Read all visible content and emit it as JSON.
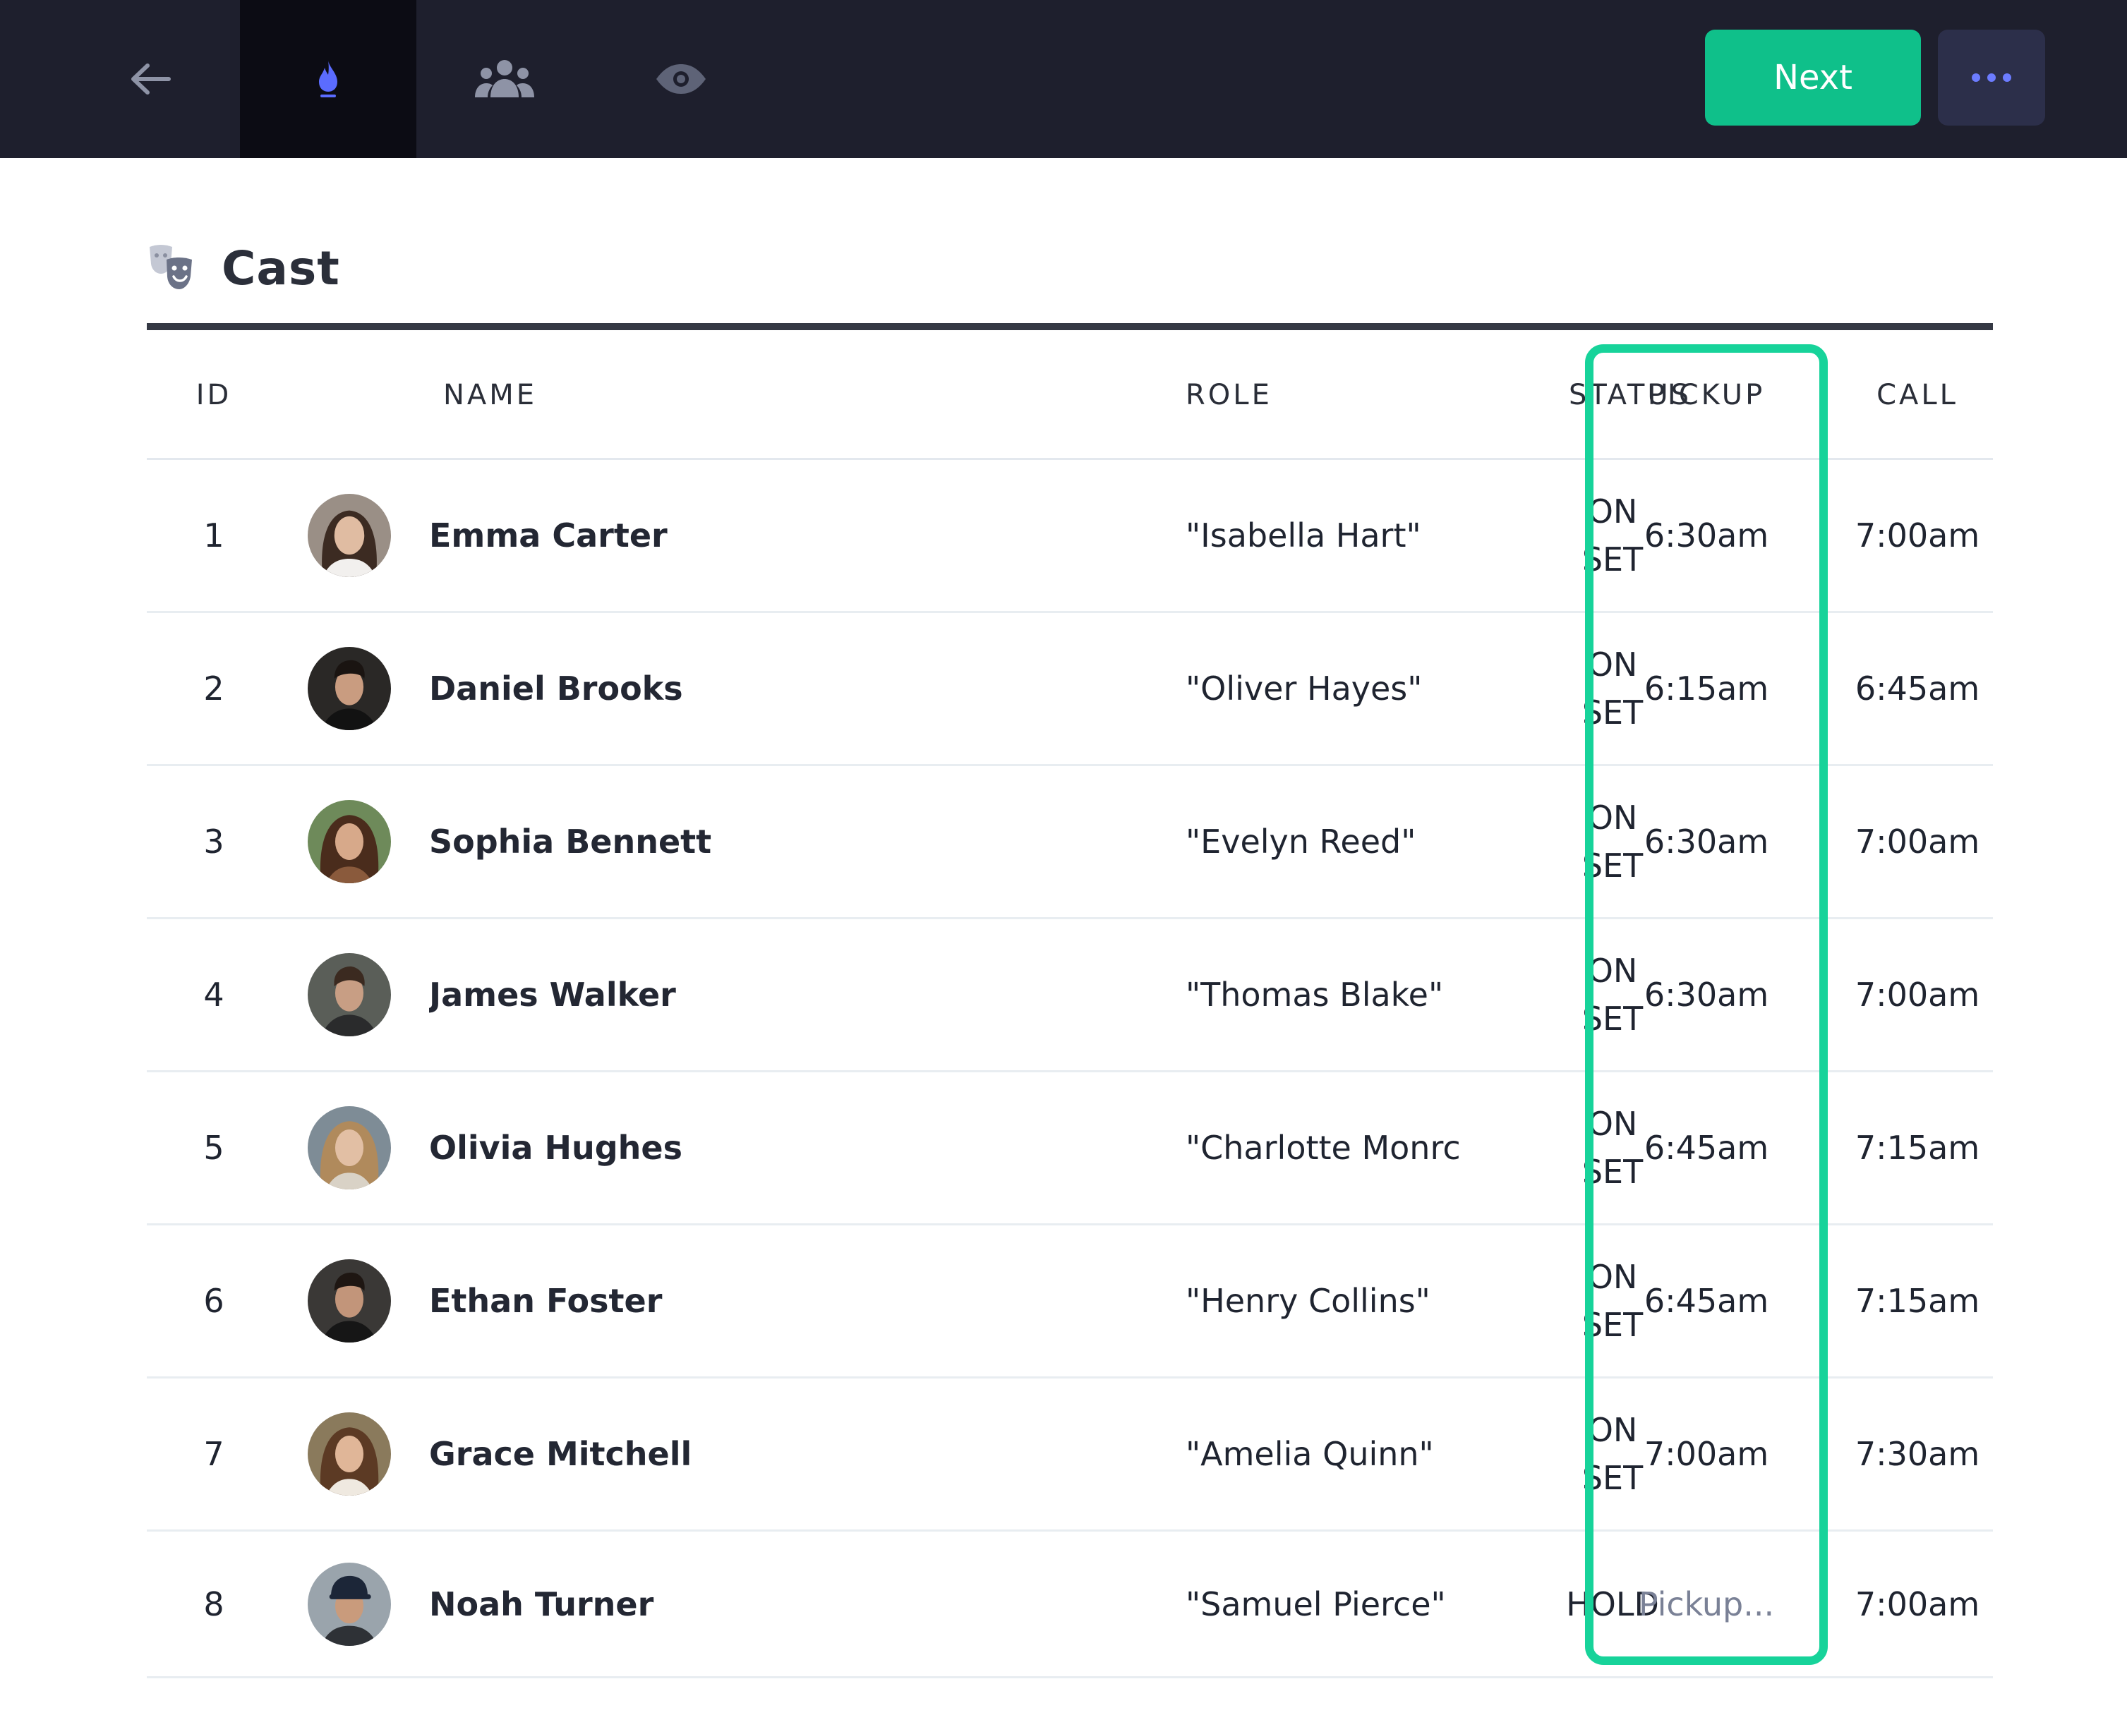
{
  "toolbar": {
    "icons": [
      "back-arrow-icon",
      "flame-icon",
      "people-group-icon",
      "eye-icon"
    ],
    "next_label": "Next",
    "more_icon": "ellipsis-icon",
    "accent_color": "#0fc08a",
    "active_icon_color": "#5b6cff"
  },
  "section": {
    "icon": "theater-masks-icon",
    "title": "Cast"
  },
  "table": {
    "headers": {
      "id": "ID",
      "name": "NAME",
      "role": "ROLE",
      "status": "STATUS",
      "pickup": "PICKUP",
      "call": "CALL"
    },
    "rows": [
      {
        "id": "1",
        "name": "Emma Carter",
        "role": "\"Isabella Hart\"",
        "status": [
          "ON",
          "SET"
        ],
        "pickup": "6:30am",
        "call": "7:00am"
      },
      {
        "id": "2",
        "name": "Daniel Brooks",
        "role": "\"Oliver Hayes\"",
        "status": [
          "ON",
          "SET"
        ],
        "pickup": "6:15am",
        "call": "6:45am"
      },
      {
        "id": "3",
        "name": "Sophia Bennett",
        "role": "\"Evelyn Reed\"",
        "status": [
          "ON",
          "SET"
        ],
        "pickup": "6:30am",
        "call": "7:00am"
      },
      {
        "id": "4",
        "name": "James Walker",
        "role": "\"Thomas Blake\"",
        "status": [
          "ON",
          "SET"
        ],
        "pickup": "6:30am",
        "call": "7:00am"
      },
      {
        "id": "5",
        "name": "Olivia Hughes",
        "role": "\"Charlotte Monrc",
        "status": [
          "ON",
          "SET"
        ],
        "pickup": "6:45am",
        "call": "7:15am"
      },
      {
        "id": "6",
        "name": "Ethan Foster",
        "role": "\"Henry Collins\"",
        "status": [
          "ON",
          "SET"
        ],
        "pickup": "6:45am",
        "call": "7:15am"
      },
      {
        "id": "7",
        "name": "Grace Mitchell",
        "role": "\"Amelia Quinn\"",
        "status": [
          "ON",
          "SET"
        ],
        "pickup": "7:00am",
        "call": "7:30am"
      },
      {
        "id": "8",
        "name": "Noah Turner",
        "role": "\"Samuel Pierce\"",
        "status": [
          "HOLD"
        ],
        "pickup": "",
        "pickup_placeholder": "Pickup...",
        "call": "7:00am"
      }
    ]
  },
  "highlight_color": "#17d39a"
}
